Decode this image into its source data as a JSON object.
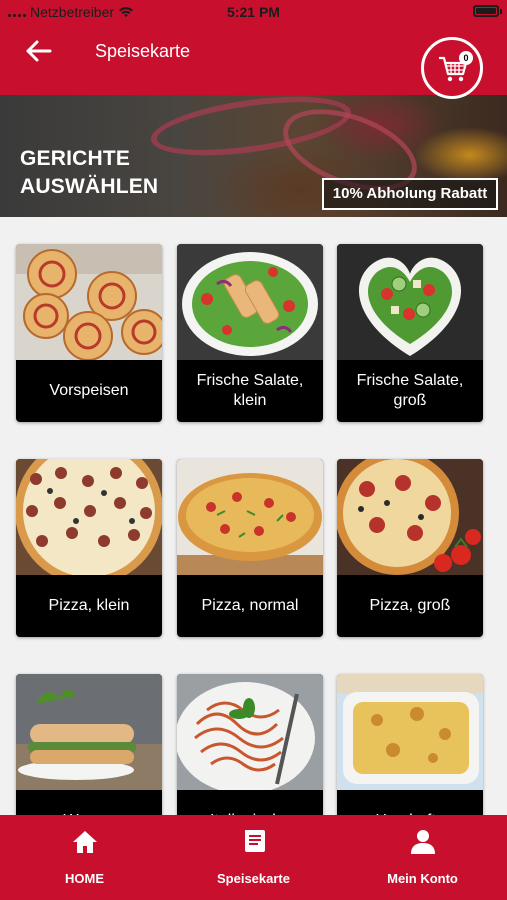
{
  "status_bar": {
    "carrier": "Netzbetreiber",
    "time": "5:21 PM"
  },
  "header": {
    "title": "Speisekarte",
    "cart_count": "0"
  },
  "banner": {
    "title_line1": "GERICHTE",
    "title_line2": "AUSWÄHLEN",
    "promo": "10% Abholung Rabatt"
  },
  "categories": [
    {
      "label": "Vorspeisen"
    },
    {
      "label": "Frische Salate, klein"
    },
    {
      "label": "Frische Salate, groß"
    },
    {
      "label": "Pizza, klein"
    },
    {
      "label": "Pizza, normal"
    },
    {
      "label": "Pizza, groß"
    },
    {
      "label": "Warme"
    },
    {
      "label": "Italienische"
    },
    {
      "label": "Herzhafte"
    }
  ],
  "bottom_nav": [
    {
      "label": "HOME",
      "icon": "home-icon"
    },
    {
      "label": "Speisekarte",
      "icon": "menu-book-icon"
    },
    {
      "label": "Mein Konto",
      "icon": "person-icon"
    }
  ],
  "colors": {
    "brand": "#c8102e",
    "card_label_bg": "#000000",
    "background": "#f1f1f1"
  }
}
